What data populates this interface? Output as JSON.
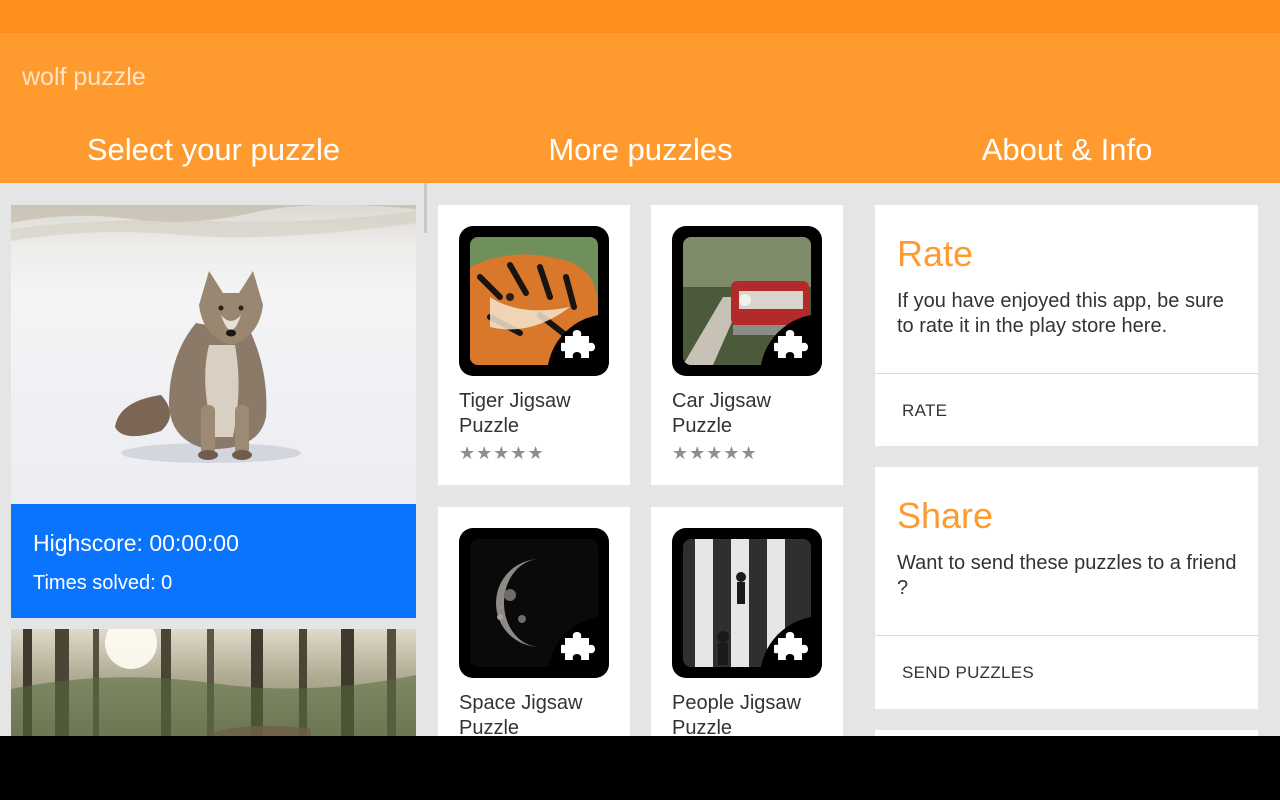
{
  "app": {
    "title": "wolf puzzle"
  },
  "tabs": [
    {
      "label": "Select your puzzle"
    },
    {
      "label": "More puzzles"
    },
    {
      "label": "About & Info"
    }
  ],
  "selected_puzzle": {
    "highscore": "Highscore: 00:00:00",
    "times_solved": "Times solved: 0"
  },
  "more_puzzles": [
    {
      "name": "Tiger Jigsaw Puzzle",
      "rating_stars": 5,
      "stars": "★★★★★"
    },
    {
      "name": "Car Jigsaw Puzzle",
      "rating_stars": 5,
      "stars": "★★★★★"
    },
    {
      "name": "Space Jigsaw Puzzle"
    },
    {
      "name": "People Jigsaw Puzzle"
    }
  ],
  "about": {
    "rate": {
      "title": "Rate",
      "text": "If you have enjoyed this app, be sure to rate it in the play store here.",
      "button": "RATE"
    },
    "share": {
      "title": "Share",
      "text": "Want to send these puzzles to a friend ?",
      "button": "SEND PUZZLES"
    }
  },
  "colors": {
    "status_bar": "#FF8E1A",
    "app_bar": "#FF9A2E",
    "accent": "#FF9A2E",
    "info_panel": "#0A74FF",
    "background": "#E5E5E5"
  },
  "icons": [
    "puzzle-piece-icon",
    "star-icon"
  ]
}
